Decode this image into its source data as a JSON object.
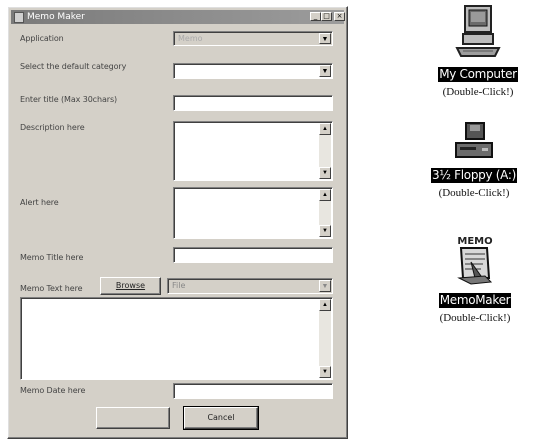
{
  "window": {
    "title": "Memo Maker",
    "controls": [
      "minimize",
      "maximize",
      "close"
    ]
  },
  "form": {
    "application_label": "Application",
    "application_value": "Memo",
    "category_label": "Select the default category",
    "title_label": "Enter title (Max 30chars)",
    "description_label": "Description here",
    "alert_label": "Alert here",
    "memo_title_label": "Memo Title here",
    "memo_text_label": "Memo Text here",
    "browse_label": "Browse",
    "file_value": "File",
    "memo_date_label": "Memo Date here",
    "ok_label": "",
    "cancel_label": "Cancel"
  },
  "desktop": [
    {
      "label": "My Computer",
      "hint": "(Double-Click!)",
      "icon": "computer-icon"
    },
    {
      "label": "3½ Floppy (A:)",
      "hint": "(Double-Click!)",
      "icon": "floppy-drive-icon"
    },
    {
      "label": "MemoMaker",
      "hint": "(Double-Click!)",
      "icon": "memo-maker-icon"
    }
  ]
}
